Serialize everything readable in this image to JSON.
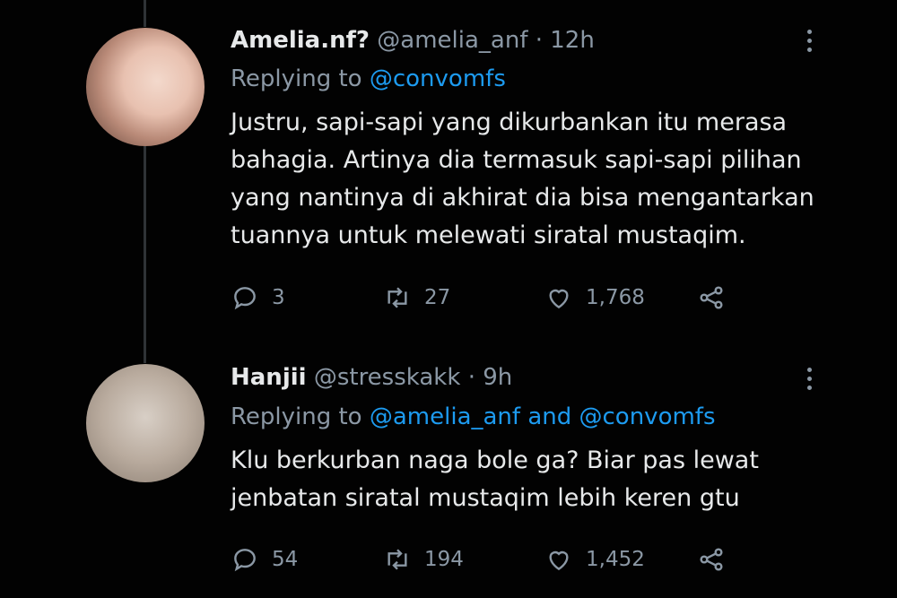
{
  "tweets": [
    {
      "name": "Amelia.nf?",
      "handle": "@amelia_anf",
      "separator": "·",
      "time": "12h",
      "replying_prefix": "Replying to",
      "replying_mentions": "@convomfs",
      "text_lines": [
        "Justru, sapi-sapi yang dikurbankan itu merasa",
        "bahagia. Artinya dia termasuk sapi-sapi pilihan",
        "yang nantinya di akhirat dia bisa mengantarkan",
        "tuannya untuk melewati siratal mustaqim."
      ],
      "replies": "3",
      "retweets": "27",
      "likes": "1,768"
    },
    {
      "name": "Hanjii",
      "handle": "@stresskakk",
      "separator": "·",
      "time": "9h",
      "replying_prefix": "Replying to",
      "replying_mentions": "@amelia_anf and @convomfs",
      "text_lines": [
        "Klu berkurban naga bole ga? Biar pas lewat",
        "jenbatan siratal mustaqim lebih keren gtu"
      ],
      "replies": "54",
      "retweets": "194",
      "likes": "1,452"
    }
  ],
  "icons": {
    "reply": "reply-icon",
    "retweet": "retweet-icon",
    "like": "heart-icon",
    "share": "share-icon",
    "more": "more-vertical-icon"
  },
  "colors": {
    "background": "#020202",
    "text": "#e7e9ea",
    "muted": "#8b98a5",
    "link": "#1d9bf0"
  }
}
